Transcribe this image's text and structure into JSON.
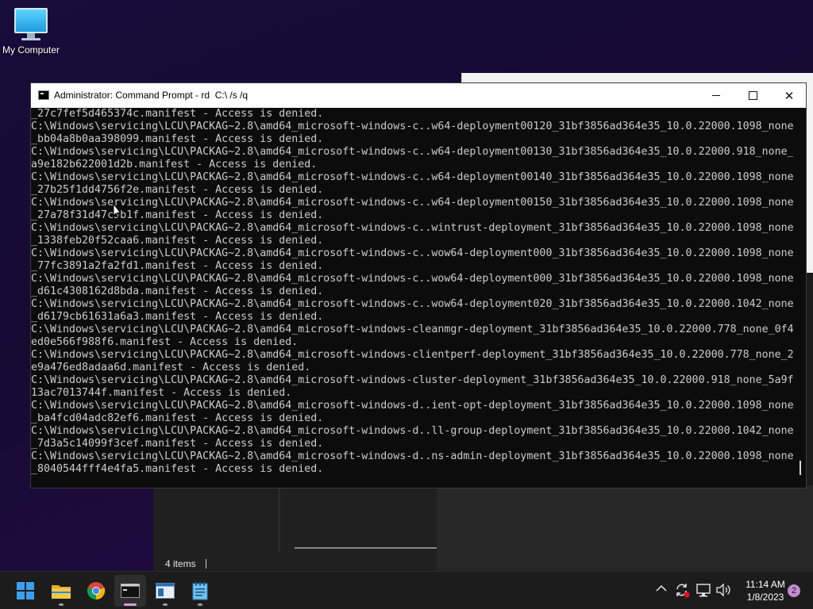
{
  "desktop": {
    "icons": [
      {
        "label": "My Computer",
        "icon": "monitor-icon"
      }
    ]
  },
  "background_window": {
    "status_text": "4 items"
  },
  "cmd_window": {
    "title": "Administrator: Command Prompt - rd  C:\\ /s /q",
    "buttons": {
      "minimize": "minimize-icon",
      "maximize": "maximize-icon",
      "close": "close-icon"
    },
    "lines": [
      "_27c7fef5d465374c.manifest - Access is denied.",
      "C:\\Windows\\servicing\\LCU\\PACKAG~2.8\\amd64_microsoft-windows-c..w64-deployment00120_31bf3856ad364e35_10.0.22000.1098_none",
      "_bb04a8b0aa398099.manifest - Access is denied.",
      "C:\\Windows\\servicing\\LCU\\PACKAG~2.8\\amd64_microsoft-windows-c..w64-deployment00130_31bf3856ad364e35_10.0.22000.918_none_",
      "a9e182b622001d2b.manifest - Access is denied.",
      "C:\\Windows\\servicing\\LCU\\PACKAG~2.8\\amd64_microsoft-windows-c..w64-deployment00140_31bf3856ad364e35_10.0.22000.1098_none",
      "_27b25f1dd4756f2e.manifest - Access is denied.",
      "C:\\Windows\\servicing\\LCU\\PACKAG~2.8\\amd64_microsoft-windows-c..w64-deployment00150_31bf3856ad364e35_10.0.22000.1098_none",
      "_27a78f31d47c3b1f.manifest - Access is denied.",
      "C:\\Windows\\servicing\\LCU\\PACKAG~2.8\\amd64_microsoft-windows-c..wintrust-deployment_31bf3856ad364e35_10.0.22000.1098_none",
      "_1338feb20f52caa6.manifest - Access is denied.",
      "C:\\Windows\\servicing\\LCU\\PACKAG~2.8\\amd64_microsoft-windows-c..wow64-deployment000_31bf3856ad364e35_10.0.22000.1098_none",
      "_77fc3891a2fa2fd1.manifest - Access is denied.",
      "C:\\Windows\\servicing\\LCU\\PACKAG~2.8\\amd64_microsoft-windows-c..wow64-deployment000_31bf3856ad364e35_10.0.22000.1098_none",
      "_d61c4308162d8bda.manifest - Access is denied.",
      "C:\\Windows\\servicing\\LCU\\PACKAG~2.8\\amd64_microsoft-windows-c..wow64-deployment020_31bf3856ad364e35_10.0.22000.1042_none",
      "_d6179cb61631a6a3.manifest - Access is denied.",
      "C:\\Windows\\servicing\\LCU\\PACKAG~2.8\\amd64_microsoft-windows-cleanmgr-deployment_31bf3856ad364e35_10.0.22000.778_none_0f4",
      "ed0e566f988f6.manifest - Access is denied.",
      "C:\\Windows\\servicing\\LCU\\PACKAG~2.8\\amd64_microsoft-windows-clientperf-deployment_31bf3856ad364e35_10.0.22000.778_none_2",
      "e9a476ed8adaa6d.manifest - Access is denied.",
      "C:\\Windows\\servicing\\LCU\\PACKAG~2.8\\amd64_microsoft-windows-cluster-deployment_31bf3856ad364e35_10.0.22000.918_none_5a9f",
      "13ac7013744f.manifest - Access is denied.",
      "C:\\Windows\\servicing\\LCU\\PACKAG~2.8\\amd64_microsoft-windows-d..ient-opt-deployment_31bf3856ad364e35_10.0.22000.1098_none",
      "_ba4fcd04adc82ef6.manifest - Access is denied.",
      "C:\\Windows\\servicing\\LCU\\PACKAG~2.8\\amd64_microsoft-windows-d..ll-group-deployment_31bf3856ad364e35_10.0.22000.1042_none",
      "_7d3a5c14099f3cef.manifest - Access is denied.",
      "C:\\Windows\\servicing\\LCU\\PACKAG~2.8\\amd64_microsoft-windows-d..ns-admin-deployment_31bf3856ad364e35_10.0.22000.1098_none",
      "_8040544fff4e4fa5.manifest - Access is denied."
    ]
  },
  "taskbar": {
    "apps": [
      {
        "name": "start-button",
        "icon": "windows-logo-icon"
      },
      {
        "name": "file-explorer",
        "icon": "folder-icon"
      },
      {
        "name": "chrome",
        "icon": "chrome-icon"
      },
      {
        "name": "command-prompt",
        "icon": "terminal-icon",
        "active": true
      },
      {
        "name": "window-app",
        "icon": "window-icon"
      },
      {
        "name": "notepad",
        "icon": "notepad-icon"
      }
    ],
    "tray": {
      "time": "11:14 AM",
      "date": "1/8/2023",
      "notification_count": "2"
    }
  },
  "colors": {
    "console_bg": "#0c0c0c",
    "console_fg": "#cccccc",
    "taskbar_bg": "#1c1c1c",
    "accent": "#d49ad9"
  }
}
